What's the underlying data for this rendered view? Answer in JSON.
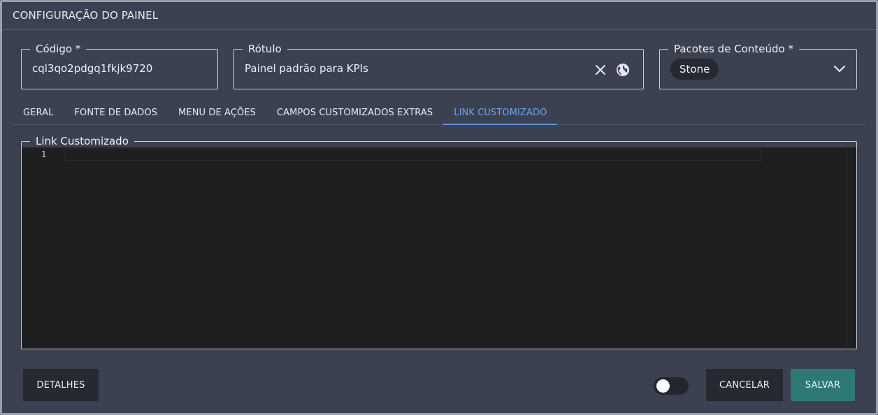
{
  "dialog": {
    "title": "CONFIGURAÇÃO DO PAINEL"
  },
  "fields": {
    "code": {
      "label": "Código *",
      "value": "cql3qo2pdgq1fkjk9720"
    },
    "label": {
      "label": "Rótulo",
      "value": "Painel padrão para KPIs",
      "clear_icon": "close-icon",
      "globe_icon": "globe-icon"
    },
    "packages": {
      "label": "Pacotes de Conteúdo *",
      "selected": [
        "Stone"
      ],
      "dropdown_icon": "chevron-down-icon"
    }
  },
  "tabs": [
    {
      "label": "GERAL",
      "active": false
    },
    {
      "label": "FONTE DE DADOS",
      "active": false
    },
    {
      "label": "MENU DE AÇÕES",
      "active": false
    },
    {
      "label": "CAMPOS CUSTOMIZADOS EXTRAS",
      "active": false
    },
    {
      "label": "LINK CUSTOMIZADO",
      "active": true
    }
  ],
  "editor": {
    "label": "Link Customizado",
    "lines": [
      "1"
    ],
    "content": ""
  },
  "footer": {
    "details_label": "DETALHES",
    "toggle_on": false,
    "cancel_label": "CANCELAR",
    "save_label": "SALVAR"
  },
  "colors": {
    "background": "#3b4150",
    "accent_tab": "#6fa4f2",
    "save_button": "#2d7a75",
    "dark_button": "#262931",
    "editor_bg": "#1f1f1f"
  }
}
